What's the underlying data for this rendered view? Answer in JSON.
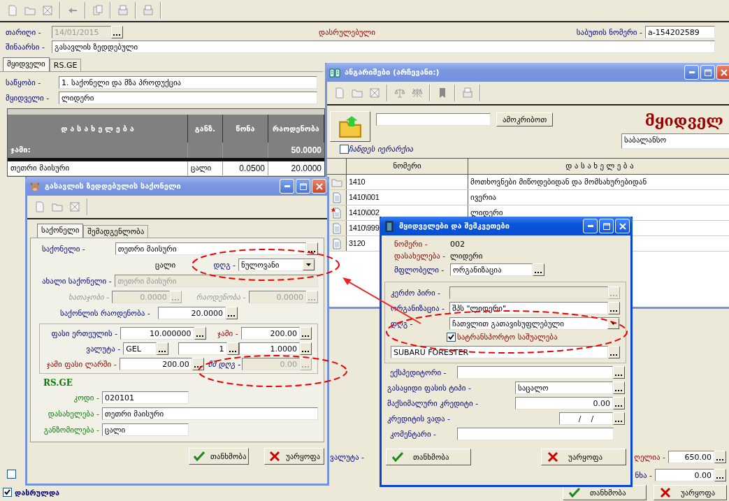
{
  "main": {
    "date": {
      "label": "თარიღი -",
      "value": "14/01/2015",
      "disabled": true
    },
    "status": "დასრულებული",
    "doc_number": {
      "label": "საბუთის ნომერი -",
      "value": "a-154202589"
    },
    "content": {
      "label": "შინაარსი -",
      "value": "გასავლის ზედდებული"
    },
    "tabs": [
      {
        "label": "მყიდველი",
        "selected": true
      },
      {
        "label": "RS.GE",
        "selected": false
      }
    ],
    "warehouse": {
      "label": "საწყობი -",
      "value": "1. საქონელი და მზა პროდუქცია"
    },
    "buyer": {
      "label": "მყიდველი -",
      "value": "ლიდერი"
    },
    "table": {
      "columns": [
        "დ ა ს ა ხ ე ლ ე ბ ა",
        "განზ.",
        "წონა",
        "რაოდენობა"
      ],
      "total": {
        "label": "ჯამი:",
        "quantity": "50.0000"
      },
      "rows": [
        {
          "name": "თეთრი მაისური",
          "unit": "ცალი",
          "weight": "0.0500",
          "quantity": "20.0000"
        }
      ]
    },
    "currency_label": "ვალუტა -",
    "totals": [
      {
        "label": "ღელია -",
        "value": "650.00"
      },
      {
        "label": "ნხა -",
        "value": "0.00"
      }
    ],
    "left_checkbox": {
      "checked": false
    },
    "finished": {
      "label": "დასრულდა",
      "checked": true
    },
    "buttons": [
      {
        "kind": "ok",
        "label": "თანხმობა"
      },
      {
        "kind": "cancel",
        "label": "უარყოფა"
      }
    ]
  },
  "accounts": {
    "title": "ანგარიშები (არჩევანი:)",
    "search_button": "ამოკრიბოთ",
    "heading": "მყიდველ",
    "hierarchy": {
      "label": "ჩანდეს იერარქია",
      "checked": false
    },
    "balance": "საბალანსო",
    "columns": [
      "ნომერი",
      "დ ა ს ა ხ ე ლ ე ბ ა"
    ],
    "rows": [
      {
        "kind": "folder",
        "number": "1410",
        "name": "მოთხოვნები მიწოდებიდან და მომსახურებიდან"
      },
      {
        "kind": "document",
        "number": "1410\\001",
        "name": "ივერია"
      },
      {
        "kind": "starred",
        "number": "1410\\002",
        "name": "ლიდერი"
      },
      {
        "kind": "document",
        "number": "1410\\999"
      },
      {
        "kind": "document",
        "number": "3120"
      }
    ]
  },
  "goods": {
    "title": "გასავლის ზედდებულის საქონელი",
    "tabs": [
      {
        "label": "საქონელი",
        "selected": true
      },
      {
        "label": "შემადგენლობა",
        "selected": false
      }
    ],
    "goods": {
      "label": "საქონელი -",
      "value": "თეთრი მაისური"
    },
    "unit": "ცალი",
    "vat": {
      "label": "დღგ -",
      "value": "ნულოვანი"
    },
    "new_goods": {
      "label": "ახალი საქონელი -",
      "value": "თეთრი მაისური",
      "disabled": true
    },
    "disabled_pair": [
      {
        "label": "ხათაჯობი -",
        "value": "0.0000",
        "disabled": true
      },
      {
        "label": "რაოდენობა -",
        "value": "0.0000",
        "disabled": true
      }
    ],
    "quantity": {
      "label": "საქონლის რაოდენობა -",
      "value": "20.0000"
    },
    "price": {
      "label": "ფასი ერთეულის -",
      "value": "10.000000"
    },
    "sum": {
      "label": "ჯამი -",
      "value": "200.00"
    },
    "currency": {
      "label": "ვალუტა -",
      "code": "GEL",
      "factor": "1",
      "rate": "1.0000"
    },
    "sum_gel": {
      "label": "ჯამი ფასი ლარში -",
      "value": "200.00"
    },
    "vat_amount": {
      "label": "მშ დღგ -",
      "value": "0.00",
      "disabled": true
    },
    "rs_heading": "RS.GE",
    "rs_fields": [
      {
        "label": "კოდი -",
        "value": "020101"
      },
      {
        "label": "დასახელება -",
        "value": "თეთრი მაისური"
      },
      {
        "label": "განზომილება -",
        "value": "ცალი"
      }
    ],
    "buttons": [
      {
        "kind": "ok",
        "label": "თანხმობა"
      },
      {
        "kind": "cancel",
        "label": "უარყოფა"
      }
    ]
  },
  "client": {
    "title": "მყიდველები და შემკვეთები",
    "number": {
      "label": "ნომერი -",
      "value": "002"
    },
    "name": {
      "label": "დასახელება -",
      "value": "ლიდერი"
    },
    "owner": {
      "label": "მფლობელი -",
      "value": "ორგანიზაცია"
    },
    "person": {
      "label": "კერძო პირი -",
      "disabled": true
    },
    "organization": {
      "label": "ორგანიზაცია -",
      "value": "შპს \"ლიდერი\""
    },
    "vat": {
      "label": "დღგ -",
      "value": "ჩათვლით გათავისუფლებული"
    },
    "vehicle": {
      "label": "სატრანსპორტო საშუალება",
      "checked": true,
      "value": "SUBARU FORESTER"
    },
    "forwarder": {
      "label": "ექსპედიტორი -"
    },
    "price_type": {
      "label": "გასაყიდი ფასის ტიპი -",
      "value": "საცალო"
    },
    "max_credit": {
      "label": "მაქსიმალური კრედიტი -",
      "value": "0.00"
    },
    "credit_term": {
      "label": "კრედიტის ვადა -",
      "value": "/    /"
    },
    "comment": {
      "label": "კომენტარი -"
    },
    "buttons": [
      {
        "kind": "ok",
        "label": "თანხმობა"
      },
      {
        "kind": "cancel",
        "label": "უარყოფა"
      }
    ]
  }
}
